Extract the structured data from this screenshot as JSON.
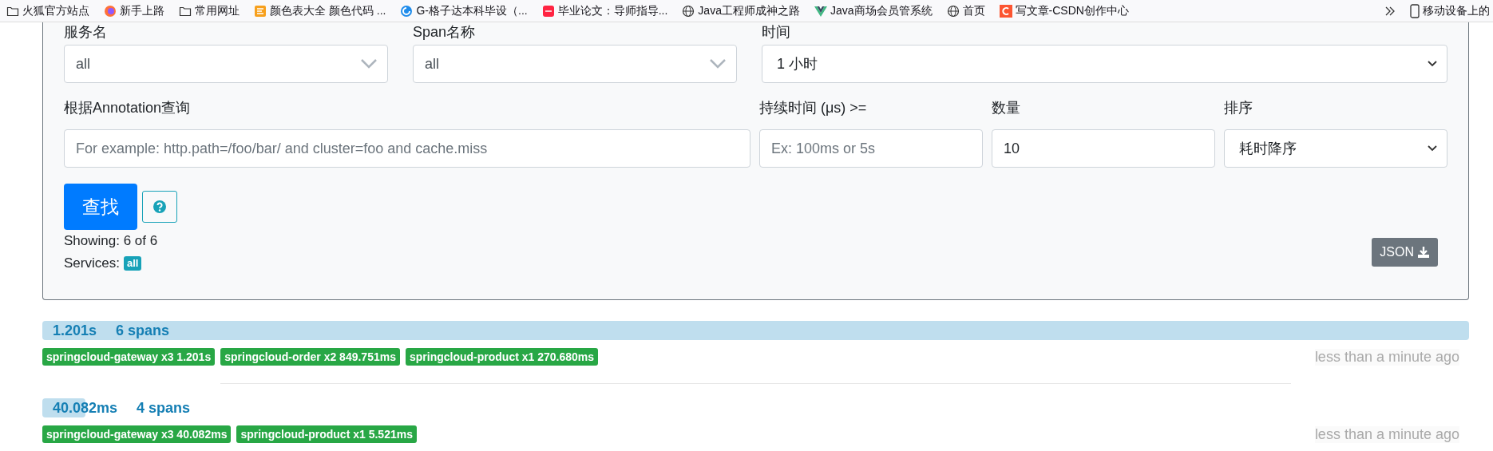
{
  "bookmarks": [
    {
      "label": "火狐官方站点",
      "kind": "folder"
    },
    {
      "label": "新手上路",
      "kind": "browser"
    },
    {
      "label": "常用网址",
      "kind": "folder"
    },
    {
      "label": "颜色表大全 颜色代码 ...",
      "kind": "palette"
    },
    {
      "label": "G-格子达本科毕设（...",
      "kind": "swirl"
    },
    {
      "label": "毕业论文：导师指导...",
      "kind": "redsquare"
    },
    {
      "label": "Java工程师成神之路",
      "kind": "globe"
    },
    {
      "label": "Java商场会员管系统",
      "kind": "vee"
    },
    {
      "label": "首页",
      "kind": "globe"
    },
    {
      "label": "写文章-CSDN创作中心",
      "kind": "csquare"
    }
  ],
  "mobile_bookmarks": "移动设备上的",
  "filters": {
    "service": {
      "label": "服务名",
      "value": "all"
    },
    "span": {
      "label": "Span名称",
      "value": "all"
    },
    "time": {
      "label": "时间",
      "value": "1 小时"
    },
    "annotation": {
      "label": "根据Annotation查询",
      "placeholder": "For example: http.path=/foo/bar/ and cluster=foo and cache.miss"
    },
    "duration": {
      "label": "持续时间 (μs) >=",
      "placeholder": "Ex: 100ms or 5s"
    },
    "limit": {
      "label": "数量",
      "value": "10"
    },
    "sort": {
      "label": "排序",
      "value": "耗时降序"
    }
  },
  "search_button": "查找",
  "showing": "Showing: 6 of 6",
  "services_label": "Services:",
  "services_badge": "all",
  "json_button": "JSON",
  "traces": [
    {
      "duration": "1.201s",
      "spans": "6 spans",
      "level": 1,
      "services": [
        "springcloud-gateway x3 1.201s",
        "springcloud-order x2 849.751ms",
        "springcloud-product x1 270.680ms"
      ],
      "time": "less than a minute ago"
    },
    {
      "duration": "40.082ms",
      "spans": "4 spans",
      "level": 0.03,
      "services": [
        "springcloud-gateway x3 40.082ms",
        "springcloud-product x1 5.521ms"
      ],
      "time": "less than a minute ago"
    }
  ]
}
